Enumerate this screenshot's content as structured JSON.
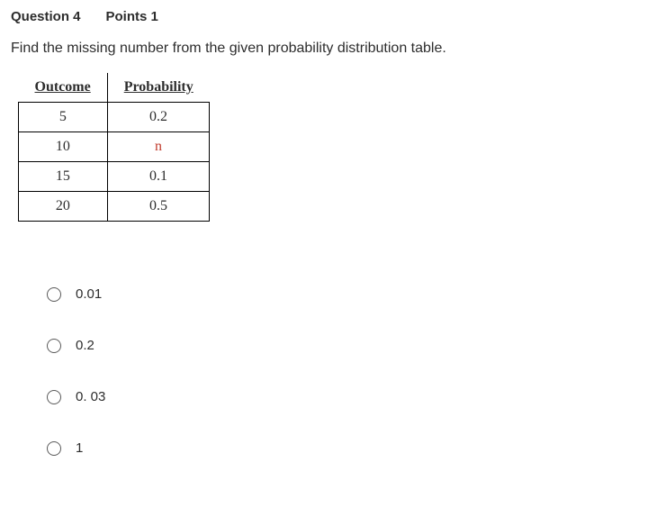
{
  "question": {
    "number_label": "Question 4",
    "points_label": "Points 1",
    "prompt": "Find the missing number from the given probability distribution table."
  },
  "table": {
    "headers": {
      "outcome": "Outcome",
      "probability": "Probability"
    },
    "rows": [
      {
        "outcome": "5",
        "probability": "0.2"
      },
      {
        "outcome": "10",
        "probability": "n"
      },
      {
        "outcome": "15",
        "probability": "0.1"
      },
      {
        "outcome": "20",
        "probability": "0.5"
      }
    ],
    "unknown_row_index": 1
  },
  "options": [
    {
      "label": "0.01"
    },
    {
      "label": "0.2"
    },
    {
      "label": "0. 03"
    },
    {
      "label": "1"
    }
  ]
}
